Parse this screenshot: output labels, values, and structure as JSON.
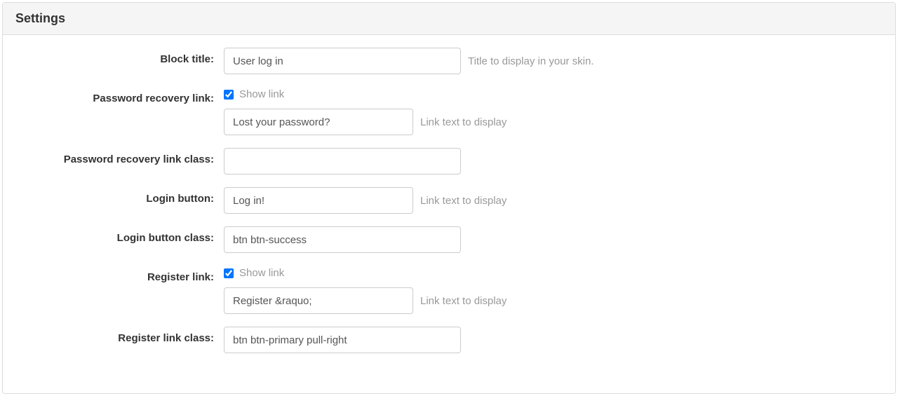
{
  "panel": {
    "title": "Settings"
  },
  "block_title": {
    "label": "Block title:",
    "value": "User log in",
    "help": "Title to display in your skin."
  },
  "password_recovery": {
    "label": "Password recovery link:",
    "show_link_label": "Show link",
    "text_value": "Lost your password?",
    "text_help": "Link text to display"
  },
  "password_recovery_class": {
    "label": "Password recovery link class:",
    "value": ""
  },
  "login_button": {
    "label": "Login button:",
    "value": "Log in!",
    "help": "Link text to display"
  },
  "login_button_class": {
    "label": "Login button class:",
    "value": "btn btn-success"
  },
  "register_link": {
    "label": "Register link:",
    "show_link_label": "Show link",
    "text_value": "Register &raquo;",
    "text_help": "Link text to display"
  },
  "register_link_class": {
    "label": "Register link class:",
    "value": "btn btn-primary pull-right"
  }
}
